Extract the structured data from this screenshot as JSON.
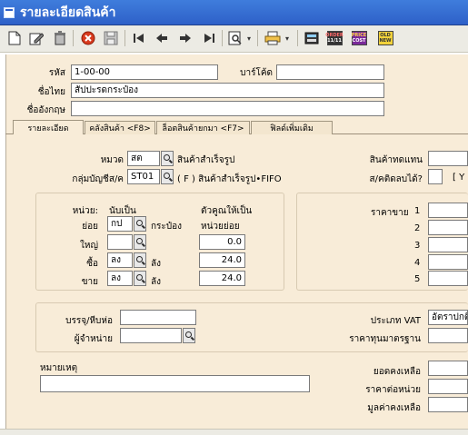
{
  "window": {
    "title": "รายละเอียดสินค้า"
  },
  "toolbar": {
    "icons": [
      "new-document",
      "edit",
      "delete",
      "cancel",
      "save",
      "first",
      "previous",
      "next",
      "last",
      "search",
      "print",
      "calculator",
      "order",
      "price-cost",
      "old-new"
    ],
    "badge_order": "ORDER",
    "badge_order_sub": "11/11",
    "badge_price": "PRICE",
    "badge_cost": "COST",
    "badge_old": "OLD",
    "badge_new": "NEW"
  },
  "header": {
    "code_label": "รหัส",
    "code_value": "1-00-00",
    "barcode_label": "บาร์โค้ด",
    "barcode_value": "",
    "thai_name_label": "ชื่อไทย",
    "thai_name_value": "สัปปะรดกระป๋อง",
    "english_name_label": "ชื่ออังกฤษ",
    "english_name_value": ""
  },
  "tabs": [
    {
      "label": "รายละเอียด",
      "active": true
    },
    {
      "label": "คลังสินค้า <F8>",
      "active": false
    },
    {
      "label": "ล็อตสินค้ายกมา <F7>",
      "active": false
    },
    {
      "label": "ฟิลด์เพิ่มเติม",
      "active": false
    }
  ],
  "details": {
    "category_label": "หมวด",
    "category_value": "สต",
    "category_desc": "สินค้าสำเร็จรูป",
    "account_group_label": "กลุ่มบัญชีส/ค",
    "account_group_value": "ST01",
    "account_group_desc": "( F )  สินค้าสำเร็จรูป•FIFO",
    "substitute_label": "สินค้าทดแทน",
    "substitute_value": "",
    "negative_stock_label": "ส/คติดลบได้?",
    "negative_stock_hint": "[ Y"
  },
  "units": {
    "header_unit": "หน่วย:",
    "header_count": "นับเป็น",
    "header_multiplier": "ตัวคูณให้เป็น",
    "header_multiplier_sub": "หน่วยย่อย",
    "rows": [
      {
        "label": "ย่อย",
        "code": "กป",
        "name": "กระป๋อง",
        "factor": ""
      },
      {
        "label": "ใหญ่",
        "code": "",
        "name": "",
        "factor": "0.0"
      },
      {
        "label": "ซื้อ",
        "code": "ลง",
        "name": "ลัง",
        "factor": "24.0"
      },
      {
        "label": "ขาย",
        "code": "ลง",
        "name": "ลัง",
        "factor": "24.0"
      }
    ]
  },
  "prices": {
    "label": "ราคาขาย",
    "levels": [
      "1",
      "2",
      "3",
      "4",
      "5"
    ]
  },
  "packaging": {
    "package_label": "บรรจุ/หีบห่อ",
    "package_value": "",
    "supplier_label": "ผู้จำหน่าย",
    "supplier_value": "",
    "vat_type_label": "ประเภท VAT",
    "vat_type_value": "อัตราปกติ",
    "std_cost_label": "ราคาทุนมาตรฐาน",
    "std_cost_value": ""
  },
  "notes": {
    "label": "หมายเหตุ",
    "value": ""
  },
  "balances": {
    "balance_label": "ยอดคงเหลือ",
    "unit_price_label": "ราคาต่อหน่วย",
    "balance_value_label": "มูลค่าคงเหลือ"
  },
  "colors": {
    "titlebar": "#2e60c8",
    "content_bg": "#f8ecd8",
    "toolbar_bg": "#ecebe4"
  }
}
